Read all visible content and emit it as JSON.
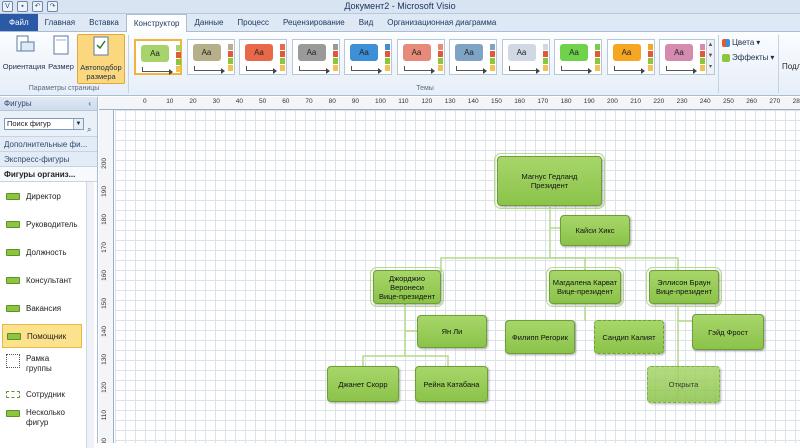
{
  "window": {
    "title": "Документ2 - Microsoft Visio"
  },
  "tabs": [
    {
      "label": "Файл"
    },
    {
      "label": "Главная"
    },
    {
      "label": "Вставка"
    },
    {
      "label": "Конструктор"
    },
    {
      "label": "Данные"
    },
    {
      "label": "Процесс"
    },
    {
      "label": "Рецензирование"
    },
    {
      "label": "Вид"
    },
    {
      "label": "Организационная диаграмма"
    }
  ],
  "ribbon": {
    "orientation": "Ориентация",
    "size": "Размер",
    "autofit_line1": "Автоподбор",
    "autofit_line2": "размера",
    "page_setup_group": "Параметры страницы",
    "themes_group": "Темы",
    "theme_sample": "Aa",
    "colors": "Цвета",
    "effects": "Эффекты",
    "cut_label": "Подл"
  },
  "themes": [
    {
      "color": "#a6d46a",
      "selected": true
    },
    {
      "color": "#b7ae8a"
    },
    {
      "color": "#e8694a"
    },
    {
      "color": "#9a9a9a"
    },
    {
      "color": "#3d8fd6"
    },
    {
      "color": "#e88a7a"
    },
    {
      "color": "#7fa3c4"
    },
    {
      "color": "#cfd8e3"
    },
    {
      "color": "#6fd24a"
    },
    {
      "color": "#f5a623"
    },
    {
      "color": "#d58ab0"
    }
  ],
  "shapes_panel": {
    "title": "Фигуры",
    "search": "Поиск фигур",
    "more_shapes": "Дополнительные фи...",
    "quick_shapes": "Экспресс-фигуры",
    "stencil_title": "Фигуры организ..."
  },
  "stencil_items": [
    {
      "label": "Директор"
    },
    {
      "label": "Руководитель"
    },
    {
      "label": "Должность"
    },
    {
      "label": "Консультант"
    },
    {
      "label": "Вакансия"
    },
    {
      "label": "Помощник"
    },
    {
      "label": "Рамка группы"
    },
    {
      "label": "Сотрудник"
    },
    {
      "label": "Несколько фигур"
    }
  ],
  "ruler": {
    "top": [
      "0",
      "10",
      "20",
      "30",
      "40",
      "50",
      "60",
      "70",
      "80",
      "90",
      "100",
      "110",
      "120",
      "130",
      "140",
      "150",
      "160",
      "170",
      "180",
      "190",
      "200",
      "210",
      "220",
      "230",
      "240",
      "250",
      "260",
      "270",
      "280",
      "290"
    ],
    "left": [
      "200",
      "190",
      "180",
      "170",
      "160",
      "150",
      "140",
      "130",
      "120",
      "110",
      "100"
    ]
  },
  "org_chart": {
    "president": {
      "name": "Магнус Гедланд",
      "title": "Президент"
    },
    "assistant": {
      "name": "Кайси Хикс"
    },
    "vp1": {
      "name1": "Джорджио",
      "name2": "Веронеси",
      "title": "Вице-президент"
    },
    "vp2": {
      "name": "Магдалена Карват",
      "title": "Вице-президент"
    },
    "vp3": {
      "name": "Эллисон Браун",
      "title": "Вице-президент"
    },
    "yan": {
      "name": "Ян Ли"
    },
    "philip": {
      "name": "Филипп Регорик"
    },
    "sandip": {
      "name": "Сандип Калият"
    },
    "gayd": {
      "name": "Гэйд Фрост"
    },
    "janet": {
      "name": "Джанет Скорр"
    },
    "reyna": {
      "name": "Рейна Катабана"
    },
    "open": {
      "name": "Открыта"
    }
  }
}
